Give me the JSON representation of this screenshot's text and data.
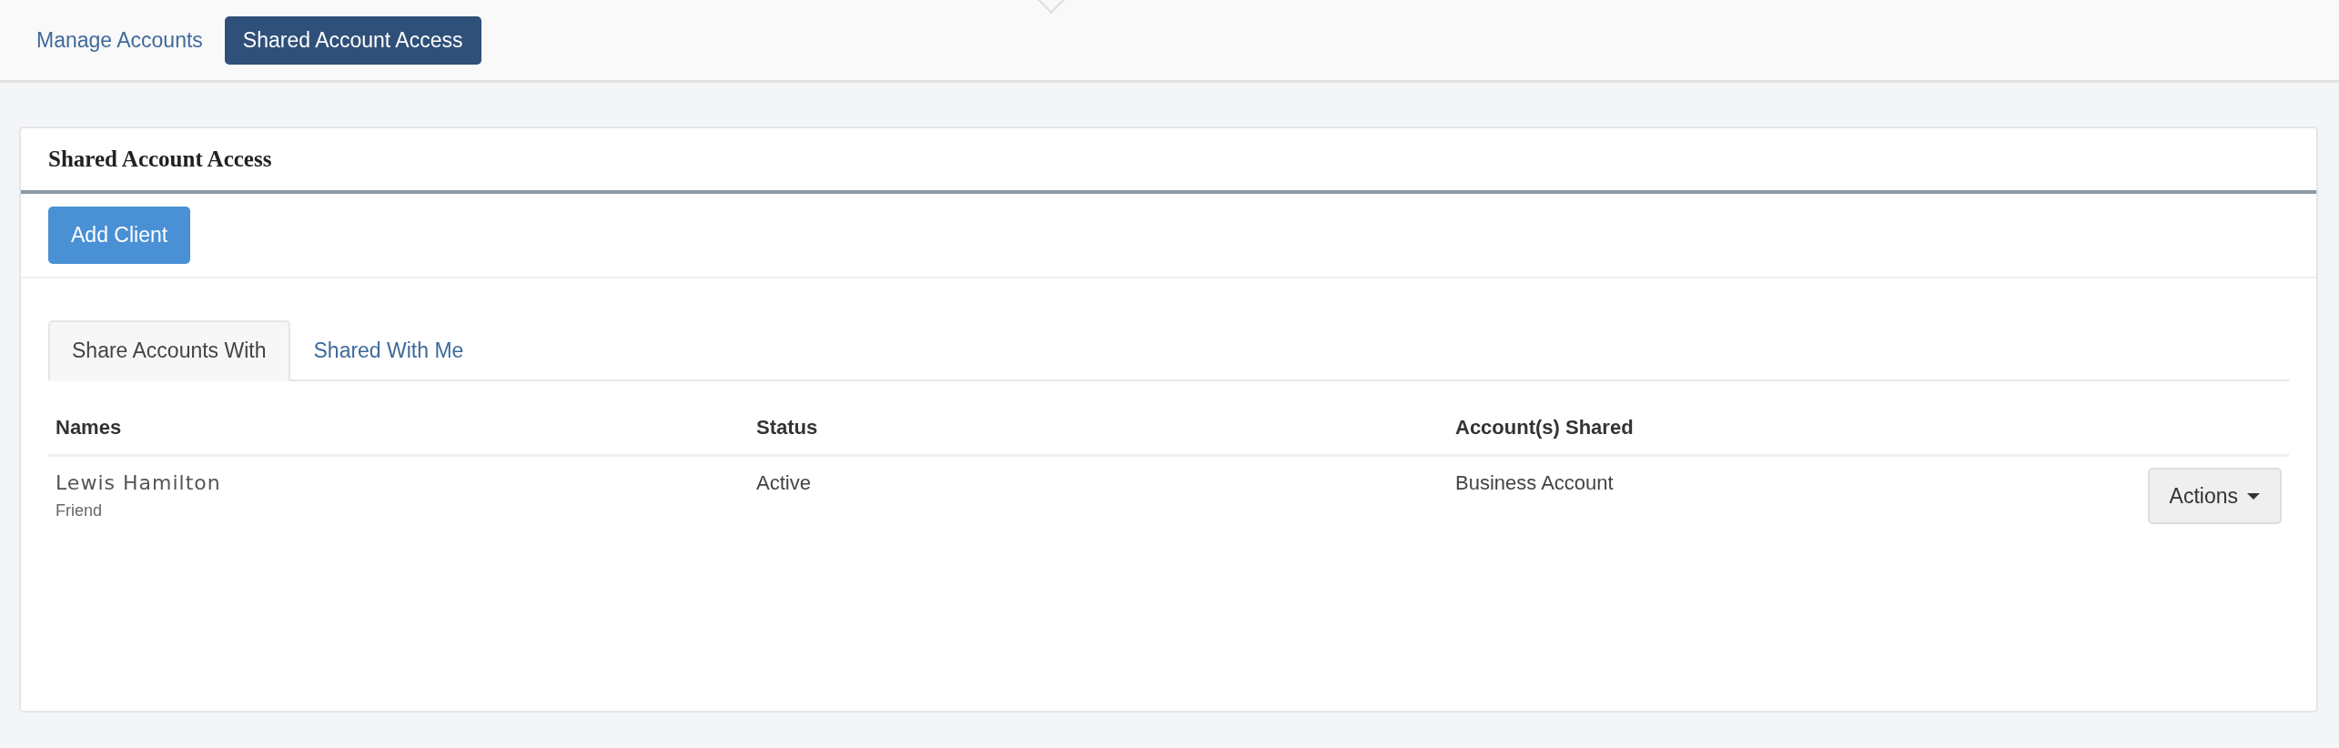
{
  "nav": {
    "items": [
      {
        "label": "Manage Accounts",
        "selected": false
      },
      {
        "label": "Shared Account Access",
        "selected": true
      }
    ]
  },
  "panel": {
    "title": "Shared Account Access",
    "add_button": "Add Client",
    "tabs": [
      {
        "label": "Share Accounts With",
        "selected": true
      },
      {
        "label": "Shared With Me",
        "selected": false
      }
    ],
    "table": {
      "columns": [
        "Names",
        "Status",
        "Account(s) Shared"
      ],
      "rows": [
        {
          "name": "Lewis Hamilton",
          "relation": "Friend",
          "status": "Active",
          "accounts": "Business Account",
          "action": "Actions"
        }
      ]
    }
  }
}
